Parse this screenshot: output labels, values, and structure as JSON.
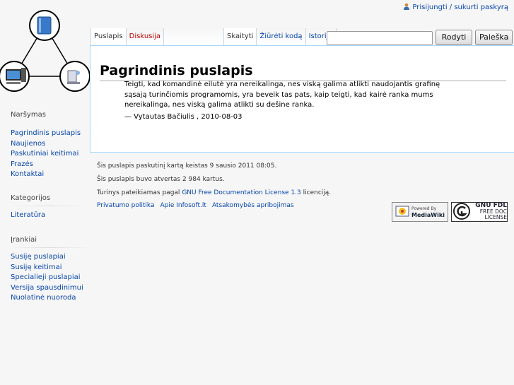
{
  "personal": {
    "login_label": "Prisijungti / sukurti paskyrą"
  },
  "tabs": {
    "left": [
      {
        "label": "Puslapis",
        "selected": true
      },
      {
        "label": "Diskusija",
        "selected": false
      }
    ],
    "right": [
      {
        "label": "Skaityti",
        "selected": true
      },
      {
        "label": "Žiūrėti kodą",
        "selected": false
      },
      {
        "label": "Istorija",
        "selected": false
      }
    ]
  },
  "search": {
    "placeholder": "",
    "value": "",
    "go_label": "Rodyti",
    "search_label": "Paieška"
  },
  "content": {
    "title": "Pagrindinis puslapis",
    "quote": "Teigti, kad komandinė eilutė yra nereikalinga, nes viską galima atlikti naudojantis grafinę sąsają turinčiomis programomis, yra beveik tas pats, kaip teigti, kad kairė ranka mums nereikalinga, nes viską galima atlikti su dešine ranka.",
    "author": "— Vytautas Bačiulis , 2010-08-03"
  },
  "sidebar": {
    "navigation": {
      "heading": "Naršymas",
      "items": [
        "Pagrindinis puslapis",
        "Naujienos",
        "Paskutiniai keitimai",
        "Frazės",
        "Kontaktai"
      ]
    },
    "categories": {
      "heading": "Kategorijos",
      "items": [
        "Literatūra"
      ]
    },
    "tools": {
      "heading": "Įrankiai",
      "items": [
        "Susiję puslapiai",
        "Susiję keitimai",
        "Specialieji puslapiai",
        "Versija spausdinimui",
        "Nuolatinė nuoroda"
      ]
    }
  },
  "footer": {
    "last_modified": "Šis puslapis paskutinį kartą keistas 9 sausio 2011 08:05.",
    "views": "Šis puslapis buvo atvertas 2 984 kartus.",
    "license_prefix": "Turinys pateikiamas pagal",
    "license_link": "GNU Free Documentation License 1.3",
    "license_suffix": "licenciją.",
    "links": [
      "Privatumo politika",
      "Apie Infosoft.lt",
      "Atsakomybės apribojimas"
    ],
    "badges": {
      "mediawiki_top": "Powered By",
      "mediawiki_bottom": "MediaWiki",
      "gfdl_1": "GNU FDL",
      "gfdl_2": "FREE DOC",
      "gfdl_3": "LICENSE"
    }
  },
  "colors": {
    "link": "#0645ad",
    "new_link": "#ba0000",
    "border": "#a7d7f9"
  }
}
